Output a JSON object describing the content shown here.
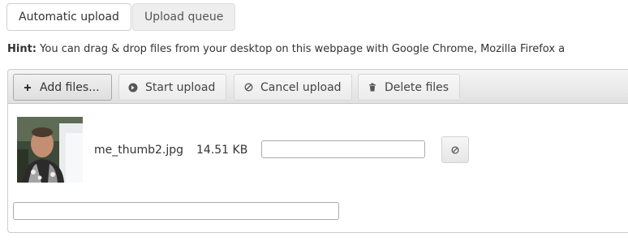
{
  "tabs": [
    {
      "label": "Automatic upload",
      "active": true
    },
    {
      "label": "Upload queue",
      "active": false
    }
  ],
  "hint": {
    "label": "Hint:",
    "text": " You can drag & drop files from your desktop on this webpage with Google Chrome, Mozilla Firefox a"
  },
  "toolbar": {
    "add_label": "Add files...",
    "start_label": "Start upload",
    "cancel_label": "Cancel upload",
    "delete_label": "Delete files"
  },
  "icons": {
    "add": "plus-icon",
    "start": "circle-arrow-right-icon",
    "cancel": "ban-icon",
    "delete": "trash-icon",
    "row_cancel": "ban-icon"
  },
  "file": {
    "name": "me_thumb2.jpg",
    "size": "14.51 KB",
    "progress": 0
  },
  "overall_progress": 0
}
